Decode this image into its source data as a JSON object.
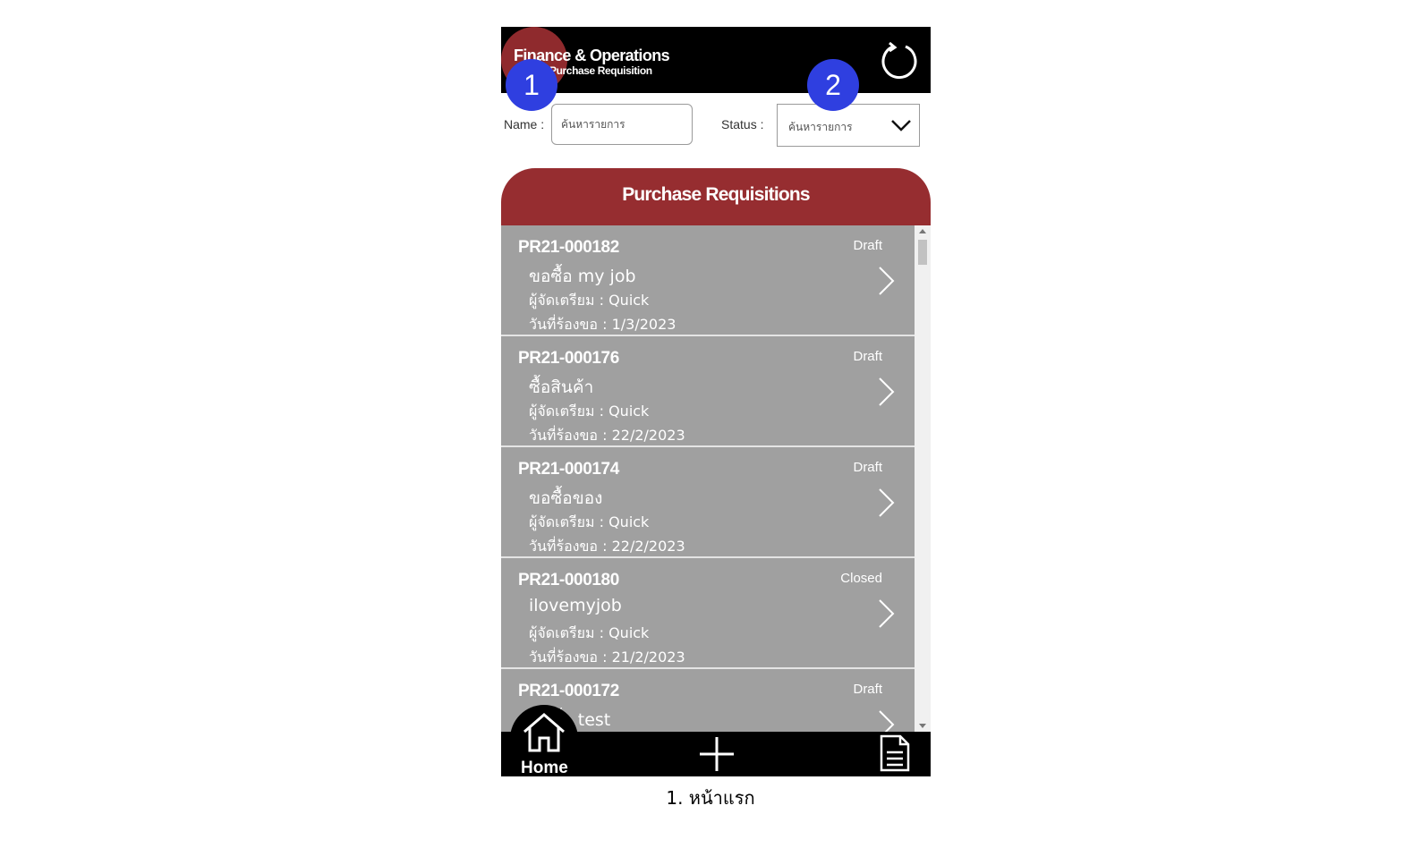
{
  "header": {
    "title": "Finance & Operations",
    "subtitle": "Purchase Requisition",
    "refresh_icon": "refresh-icon"
  },
  "filters": {
    "name_label": "Name :",
    "name_placeholder": "ค้นหารายการ",
    "status_label": "Status :",
    "status_value": "ค้นหารายการ"
  },
  "annotations": [
    "1",
    "2"
  ],
  "list": {
    "title": "Purchase Requisitions",
    "items": [
      {
        "id": "PR21-000182",
        "status": "Draft",
        "description": "ขอซื้อ my job",
        "preparer": "ผู้จัดเตรียม : Quick",
        "date": "วันที่ร้องขอ : 1/3/2023"
      },
      {
        "id": "PR21-000176",
        "status": "Draft",
        "description": "ซื้อสินค้า",
        "preparer": "ผู้จัดเตรียม : Quick",
        "date": "วันที่ร้องขอ : 22/2/2023"
      },
      {
        "id": "PR21-000174",
        "status": "Draft",
        "description": "ขอซื้อของ",
        "preparer": "ผู้จัดเตรียม : Quick",
        "date": "วันที่ร้องขอ : 22/2/2023"
      },
      {
        "id": "PR21-000180",
        "status": "Closed",
        "description": "ilovemyjob",
        "preparer": "ผู้จัดเตรียม : Quick",
        "date": "วันที่ร้องขอ : 21/2/2023"
      },
      {
        "id": "PR21-000172",
        "status": "Draft",
        "description": "ขอซื้อ test",
        "preparer": "",
        "date": ""
      }
    ]
  },
  "bottom_nav": {
    "home_label": "Home",
    "home_icon": "home-icon",
    "add_icon": "plus-icon",
    "doc_icon": "document-icon"
  },
  "caption": "1. หน้าแรก",
  "colors": {
    "header_bg": "#000000",
    "accent_red": "#962d30",
    "row_bg": "#a0a0a0",
    "badge_blue": "#2f3fe0"
  }
}
